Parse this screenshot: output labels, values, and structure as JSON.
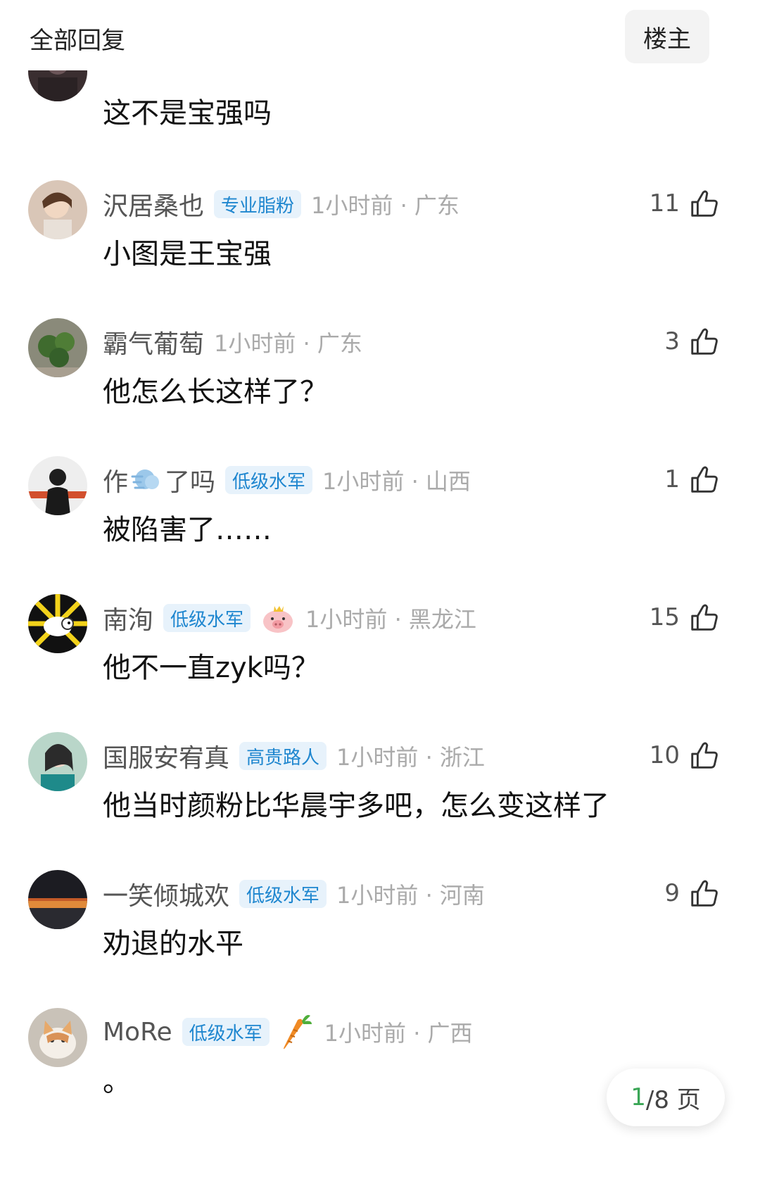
{
  "header": {
    "title": "全部回复",
    "op_button_label": "楼主"
  },
  "replies": [
    {
      "username": "",
      "badge": "",
      "time_location": "",
      "likes": "",
      "content": "这不是宝强吗"
    },
    {
      "username": "沢居桑也",
      "badge": "专业脂粉",
      "time_location": "1小时前 · 广东",
      "likes": "11",
      "content": "小图是王宝强"
    },
    {
      "username": "霸气葡萄",
      "badge": "",
      "time_location": "1小时前 · 广东",
      "likes": "3",
      "content": "他怎么长这样了？"
    },
    {
      "username_prefix": "作",
      "username_suffix": "了吗",
      "badge": "低级水军",
      "time_location": "1小时前 · 山西",
      "likes": "1",
      "content": "被陷害了……"
    },
    {
      "username": "南洵",
      "badge": "低级水军",
      "time_location": "1小时前 · 黑龙江",
      "likes": "15",
      "content": "他不一直zyk吗？"
    },
    {
      "username": "国服安宥真",
      "badge": "高贵路人",
      "time_location": "1小时前 · 浙江",
      "likes": "10",
      "content": "他当时颜粉比华晨宇多吧，怎么变这样了"
    },
    {
      "username": "一笑倾城欢",
      "badge": "低级水军",
      "time_location": "1小时前 · 河南",
      "likes": "9",
      "content": "劝退的水平"
    },
    {
      "username": "MoRe",
      "badge": "低级水军",
      "time_location": "1小时前 · 广西",
      "likes": "",
      "content": "。"
    }
  ],
  "pagination": {
    "current": "1",
    "rest": "/8 页"
  },
  "icons": {
    "like": "thumbs-up-icon",
    "wind": "wind-emoji-icon",
    "pig": "pig-emoji-icon",
    "carrot": "carrot-emoji-icon"
  },
  "colors": {
    "badge_bg": "#e7f2fb",
    "badge_text": "#1e86cf",
    "page_current": "#3aa656"
  }
}
